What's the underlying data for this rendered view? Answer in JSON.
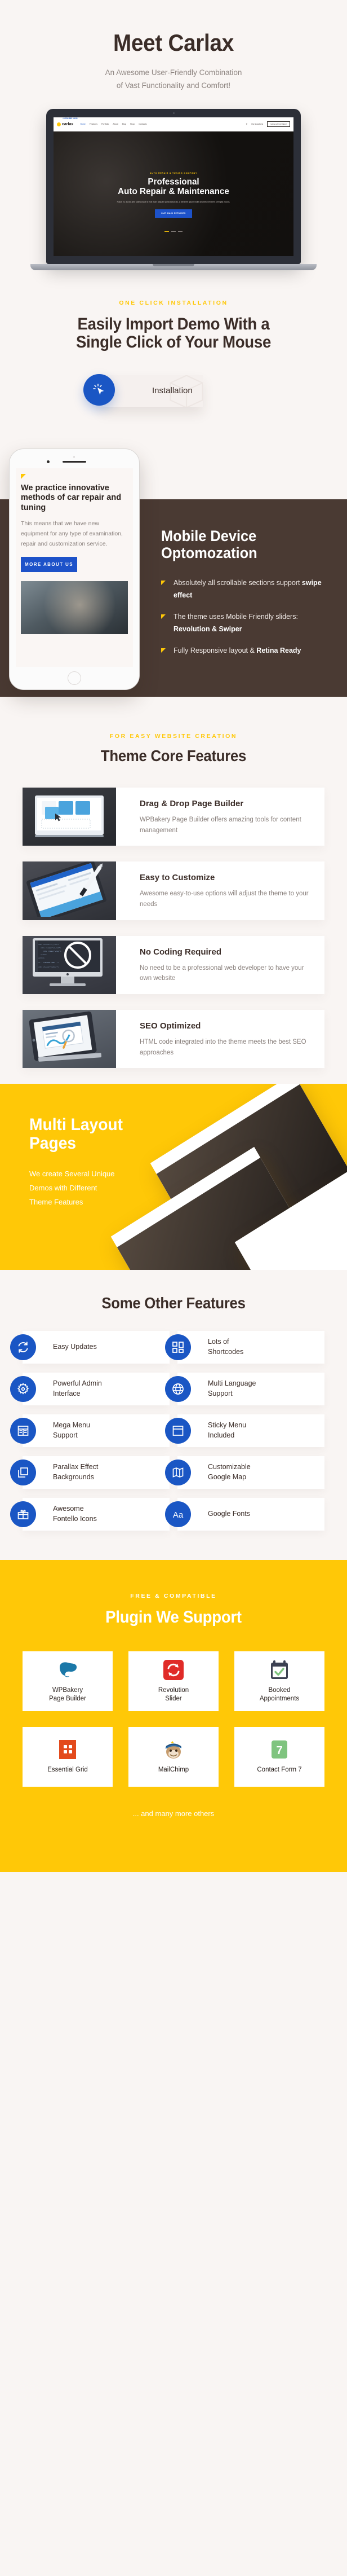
{
  "hero": {
    "title": "Meet Carlax",
    "subtitle_line1": "An Awesome User-Friendly Combination",
    "subtitle_line2": "of Vast Functionality and Comfort!",
    "laptop": {
      "logo": "carlax",
      "menu": [
        "Home",
        "Features",
        "Portfolio",
        "About",
        "Blog",
        "Shop",
        "Contacts"
      ],
      "phone": "+1 234 962 14 63",
      "location": "Our Locations",
      "appointment_button": "MAKE APPOINTMENT",
      "slide_eyebrow": "AUTO REPAIR & TUNING COMPANY",
      "slide_title_line1": "Professional",
      "slide_title_line2": "Auto Repair & Maintenance",
      "slide_text": "Fusce ex, auctor ante ullamcorque id erat vitae. Aliquam porta luctus dui, a hendrerit ipsum mollis sit amet, hendrerit a fringilla mauris.",
      "slide_button": "OUR MAIN SERVICES"
    }
  },
  "oneclick": {
    "eyebrow": "ONE CLICK INSTALLATION",
    "title_line1": "Easily Import Demo With a",
    "title_line2": "Single Click of Your Mouse",
    "card_label": "Installation",
    "icon": "cursor-click-icon"
  },
  "mobile": {
    "title_line1": "Mobile Device",
    "title_line2": "Optomozation",
    "bullets": [
      {
        "text": "Absolutely all scrollable sections support ",
        "bold": "swipe effect"
      },
      {
        "text": "The theme uses Mobile Friendly sliders: ",
        "bold": "Revolution & Swiper"
      },
      {
        "text": "Fully Responsive layout & ",
        "bold": "Retina Ready"
      }
    ],
    "phone_screen": {
      "heading": "We practice innovative methods of car repair and tuning",
      "paragraph": "This means that we have new equipment for any type of examination, repair and customization service.",
      "button": "MORE ABOUT US"
    }
  },
  "core": {
    "eyebrow": "FOR EASY WEBSITE CREATION",
    "title": "Theme Core Features",
    "cards": [
      {
        "title": "Drag & Drop Page  Builder",
        "text": "WPBakery Page Builder offers amazing tools for content management",
        "thumb": "laptop-widgets-thumb"
      },
      {
        "title": "Easy to Customize",
        "text": "Awesome easy-to-use options will adjust the theme to your needs",
        "thumb": "tablet-stylus-thumb"
      },
      {
        "title": "No Coding Required",
        "text": "No need to be a professional web developer to have your own website",
        "thumb": "imac-code-thumb"
      },
      {
        "title": "SEO Optimized",
        "text": "HTML code integrated into the theme meets the best SEO approaches",
        "thumb": "tablet-seo-thumb"
      }
    ]
  },
  "multi": {
    "title_line1": "Multi Layout",
    "title_line2": "Pages",
    "text_line1": "We create Several Unique",
    "text_line2": "Demos with Different",
    "text_line3": "Theme Features"
  },
  "other": {
    "title": "Some Other Features",
    "features": [
      {
        "label_line1": "Easy Updates",
        "label_line2": "",
        "icon": "refresh-icon"
      },
      {
        "label_line1": "Lots of",
        "label_line2": "Shortcodes",
        "icon": "grid-blocks-icon"
      },
      {
        "label_line1": "Powerful Admin",
        "label_line2": "Interface",
        "icon": "gear-icon"
      },
      {
        "label_line1": "Multi Language",
        "label_line2": "Support",
        "icon": "globe-icon"
      },
      {
        "label_line1": "Mega Menu",
        "label_line2": "Support",
        "icon": "mega-menu-icon"
      },
      {
        "label_line1": "Sticky Menu",
        "label_line2": "Included",
        "icon": "sticky-menu-icon"
      },
      {
        "label_line1": "Parallax Effect",
        "label_line2": "Backgrounds",
        "icon": "layers-icon"
      },
      {
        "label_line1": "Customizable",
        "label_line2": "Google Map",
        "icon": "map-icon"
      },
      {
        "label_line1": "Awesome",
        "label_line2": "Fontello Icons",
        "icon": "gift-icon"
      },
      {
        "label_line1": "Google Fonts",
        "label_line2": "",
        "icon": "typography-aa-icon"
      }
    ]
  },
  "plugins": {
    "eyebrow": "FREE & COMPATIBLE",
    "title": "Plugin We Support",
    "items": [
      {
        "name_line1": "WPBakery",
        "name_line2": "Page Builder",
        "icon": "wpbakery-logo-icon",
        "color": "#1b78a8"
      },
      {
        "name_line1": "Revolution",
        "name_line2": "Slider",
        "icon": "revolution-slider-logo-icon",
        "color": "#e02b28"
      },
      {
        "name_line1": "Booked",
        "name_line2": "Appointments",
        "icon": "booked-calendar-logo-icon",
        "color": "#3c4152"
      },
      {
        "name_line1": "Essential Grid",
        "name_line2": "",
        "icon": "essential-grid-logo-icon",
        "color": "#e34a1c"
      },
      {
        "name_line1": "MailChimp",
        "name_line2": "",
        "icon": "mailchimp-monkey-logo-icon",
        "color": "#8a6a3f"
      },
      {
        "name_line1": "Contact Form 7",
        "name_line2": "",
        "icon": "contact-form-7-logo-icon",
        "color": "#7fc47f"
      }
    ],
    "footer_note": "... and many more others"
  },
  "colors": {
    "accent_yellow": "#ffc807",
    "accent_blue": "#1a56c4",
    "dark_brown": "#4a3a33",
    "page_bg": "#f9f5f3",
    "text_dark": "#3b2d28",
    "text_muted": "#8a817d"
  }
}
